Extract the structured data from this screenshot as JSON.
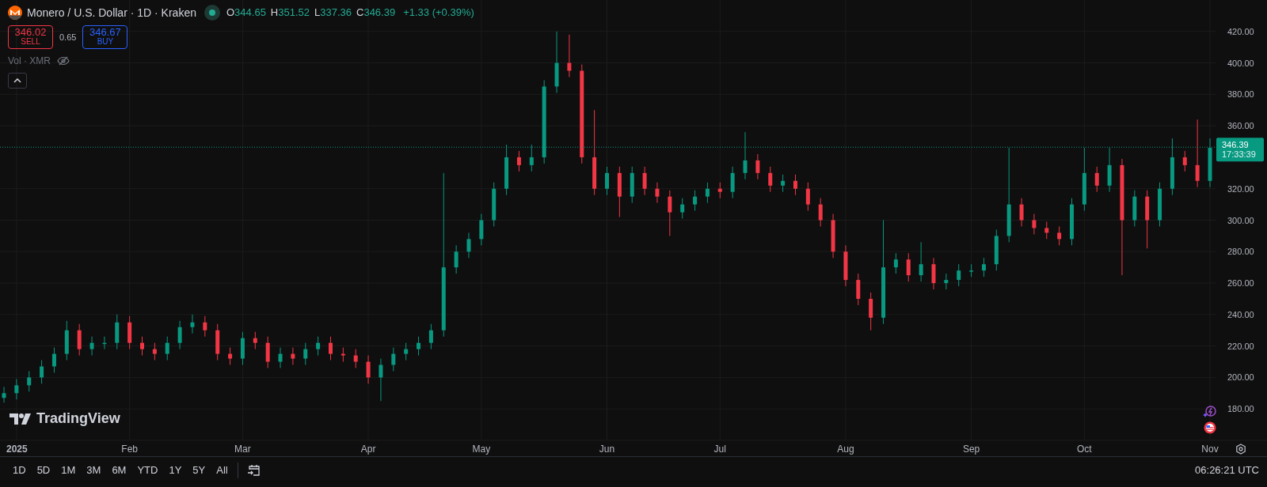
{
  "legend": {
    "title": "Monero / U.S. Dollar · 1D · Kraken",
    "market_open": true,
    "ohlc": [
      {
        "key": "O",
        "value": "344.65"
      },
      {
        "key": "H",
        "value": "351.52"
      },
      {
        "key": "L",
        "value": "337.36"
      },
      {
        "key": "C",
        "value": "346.39"
      }
    ],
    "change": "+1.33 (+0.39%)",
    "sell": {
      "price": "346.02",
      "label": "SELL"
    },
    "spread": "0.65",
    "buy": {
      "price": "346.67",
      "label": "BUY"
    },
    "volume_label": "Vol · XMR"
  },
  "chart": {
    "last_price": "346.39",
    "countdown": "17:33:39",
    "watermark": "TradingView",
    "chart_data": {
      "type": "candlestick",
      "grid": true,
      "ylim": [
        160,
        440
      ],
      "yticks": [
        {
          "value": 180,
          "label": "180.00"
        },
        {
          "value": 200,
          "label": "200.00"
        },
        {
          "value": 220,
          "label": "220.00"
        },
        {
          "value": 240,
          "label": "240.00"
        },
        {
          "value": 260,
          "label": "260.00"
        },
        {
          "value": 280,
          "label": "280.00"
        },
        {
          "value": 300,
          "label": "300.00"
        },
        {
          "value": 320,
          "label": "320.00"
        },
        {
          "value": 360,
          "label": "360.00"
        },
        {
          "value": 380,
          "label": "380.00"
        },
        {
          "value": 400,
          "label": "400.00"
        },
        {
          "value": 420,
          "label": "420.00"
        }
      ],
      "categories": [
        null,
        "2025",
        null,
        null,
        null,
        null,
        null,
        null,
        null,
        null,
        "Feb",
        null,
        null,
        null,
        null,
        null,
        null,
        null,
        null,
        "Mar",
        null,
        null,
        null,
        null,
        null,
        null,
        null,
        null,
        null,
        "Apr",
        null,
        null,
        null,
        null,
        null,
        null,
        null,
        null,
        "May",
        null,
        null,
        null,
        null,
        null,
        null,
        null,
        null,
        null,
        "Jun",
        null,
        null,
        null,
        null,
        null,
        null,
        null,
        null,
        "Jul",
        null,
        null,
        null,
        null,
        null,
        null,
        null,
        null,
        null,
        "Aug",
        null,
        null,
        null,
        null,
        null,
        null,
        null,
        null,
        null,
        "Sep",
        null,
        null,
        null,
        null,
        null,
        null,
        null,
        null,
        "Oct",
        null,
        null,
        null,
        null,
        null,
        null,
        null,
        null,
        null,
        "Nov"
      ],
      "ohlc": [
        [
          187,
          194,
          184,
          190
        ],
        [
          190,
          199,
          186,
          195
        ],
        [
          195,
          204,
          191,
          200
        ],
        [
          200,
          211,
          196,
          207
        ],
        [
          207,
          219,
          203,
          215
        ],
        [
          215,
          236,
          211,
          230
        ],
        [
          230,
          234,
          214,
          218
        ],
        [
          218,
          226,
          214,
          222
        ],
        [
          222,
          226,
          218,
          222
        ],
        [
          222,
          240,
          218,
          235
        ],
        [
          235,
          239,
          218,
          222
        ],
        [
          222,
          226,
          214,
          218
        ],
        [
          218,
          222,
          211,
          215
        ],
        [
          215,
          226,
          211,
          222
        ],
        [
          222,
          236,
          218,
          232
        ],
        [
          232,
          240,
          228,
          235
        ],
        [
          235,
          239,
          226,
          230
        ],
        [
          230,
          234,
          211,
          215
        ],
        [
          215,
          219,
          208,
          212
        ],
        [
          212,
          229,
          208,
          225
        ],
        [
          225,
          229,
          218,
          222
        ],
        [
          222,
          226,
          206,
          210
        ],
        [
          210,
          219,
          206,
          215
        ],
        [
          215,
          219,
          208,
          212
        ],
        [
          212,
          222,
          208,
          218
        ],
        [
          218,
          226,
          214,
          222
        ],
        [
          222,
          226,
          211,
          215
        ],
        [
          215,
          219,
          210,
          214
        ],
        [
          214,
          218,
          206,
          210
        ],
        [
          210,
          214,
          196,
          200
        ],
        [
          200,
          212,
          185,
          208
        ],
        [
          208,
          219,
          204,
          215
        ],
        [
          215,
          222,
          211,
          218
        ],
        [
          218,
          226,
          214,
          222
        ],
        [
          222,
          234,
          218,
          230
        ],
        [
          230,
          330,
          226,
          270
        ],
        [
          270,
          284,
          266,
          280
        ],
        [
          280,
          292,
          276,
          288
        ],
        [
          288,
          304,
          284,
          300
        ],
        [
          300,
          324,
          296,
          320
        ],
        [
          320,
          348,
          316,
          340
        ],
        [
          340,
          344,
          331,
          335
        ],
        [
          335,
          348,
          331,
          340
        ],
        [
          340,
          389,
          336,
          385
        ],
        [
          385,
          420,
          381,
          400
        ],
        [
          400,
          418,
          391,
          395
        ],
        [
          395,
          399,
          336,
          340
        ],
        [
          340,
          370,
          316,
          320
        ],
        [
          320,
          334,
          316,
          330
        ],
        [
          330,
          334,
          302,
          315
        ],
        [
          315,
          334,
          311,
          330
        ],
        [
          330,
          334,
          316,
          320
        ],
        [
          320,
          324,
          311,
          315
        ],
        [
          315,
          319,
          290,
          305
        ],
        [
          305,
          314,
          301,
          310
        ],
        [
          310,
          319,
          306,
          315
        ],
        [
          315,
          324,
          311,
          320
        ],
        [
          320,
          324,
          314,
          318
        ],
        [
          318,
          334,
          314,
          330
        ],
        [
          330,
          356,
          326,
          338
        ],
        [
          338,
          342,
          326,
          330
        ],
        [
          330,
          334,
          318,
          322
        ],
        [
          322,
          329,
          318,
          325
        ],
        [
          325,
          329,
          316,
          320
        ],
        [
          320,
          324,
          306,
          310
        ],
        [
          310,
          314,
          296,
          300
        ],
        [
          300,
          304,
          276,
          280
        ],
        [
          280,
          284,
          258,
          262
        ],
        [
          262,
          266,
          246,
          250
        ],
        [
          250,
          254,
          230,
          238
        ],
        [
          238,
          300,
          234,
          270
        ],
        [
          270,
          279,
          266,
          275
        ],
        [
          275,
          279,
          261,
          265
        ],
        [
          265,
          286,
          261,
          272
        ],
        [
          272,
          276,
          256,
          260
        ],
        [
          260,
          266,
          256,
          262
        ],
        [
          262,
          272,
          258,
          268
        ],
        [
          268,
          272,
          264,
          268
        ],
        [
          268,
          276,
          264,
          272
        ],
        [
          272,
          294,
          268,
          290
        ],
        [
          290,
          346,
          286,
          310
        ],
        [
          310,
          314,
          296,
          300
        ],
        [
          300,
          304,
          291,
          295
        ],
        [
          295,
          299,
          288,
          292
        ],
        [
          292,
          296,
          284,
          288
        ],
        [
          288,
          314,
          284,
          310
        ],
        [
          310,
          346,
          306,
          330
        ],
        [
          330,
          334,
          318,
          322
        ],
        [
          322,
          346,
          318,
          335
        ],
        [
          335,
          339,
          265,
          300
        ],
        [
          300,
          319,
          296,
          315
        ],
        [
          315,
          319,
          282,
          300
        ],
        [
          300,
          324,
          296,
          320
        ],
        [
          320,
          352,
          316,
          340
        ],
        [
          340,
          344,
          331,
          335
        ],
        [
          335,
          364,
          321,
          325
        ],
        [
          325,
          352,
          321,
          346
        ]
      ]
    }
  },
  "ranges": [
    {
      "label": "1D"
    },
    {
      "label": "5D"
    },
    {
      "label": "1M"
    },
    {
      "label": "3M"
    },
    {
      "label": "6M"
    },
    {
      "label": "YTD"
    },
    {
      "label": "1Y"
    },
    {
      "label": "5Y"
    },
    {
      "label": "All"
    }
  ],
  "clock": "06:26:21 UTC"
}
